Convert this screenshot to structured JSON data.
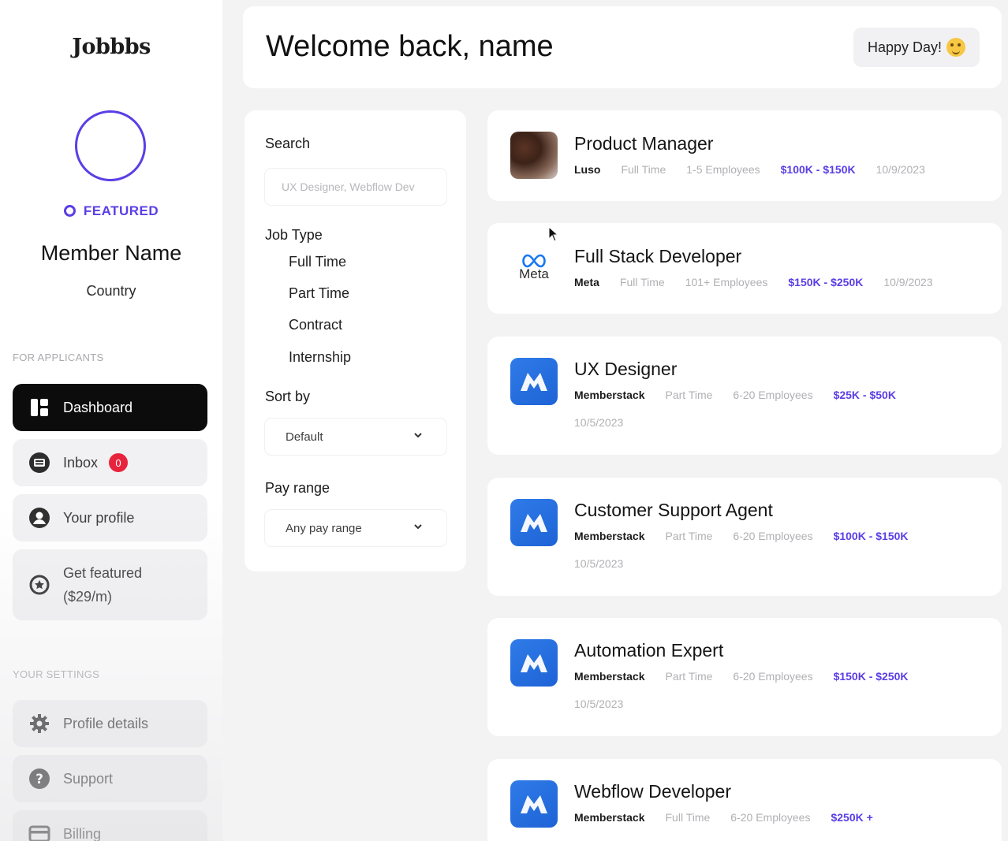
{
  "sidebar": {
    "logo": "Jobbbs",
    "featured_label": "FEATURED",
    "member_name": "Member Name",
    "country": "Country",
    "section_applicants": "FOR APPLICANTS",
    "section_settings": "YOUR SETTINGS",
    "nav": [
      {
        "label": "Dashboard",
        "icon": "dashboard-icon",
        "active": true
      },
      {
        "label": "Inbox",
        "icon": "inbox-icon",
        "badge": "0"
      },
      {
        "label": "Your profile",
        "icon": "user-icon"
      },
      {
        "label": "Get featured",
        "label2": "($29/m)",
        "icon": "star-badge-icon"
      }
    ],
    "settings": [
      {
        "label": "Profile details",
        "icon": "gear-icon"
      },
      {
        "label": "Support",
        "icon": "help-icon"
      },
      {
        "label": "Billing",
        "icon": "credit-card-icon"
      }
    ]
  },
  "header": {
    "welcome": "Welcome back, name",
    "greeting": "Happy Day!",
    "greeting_icon": "party-face-icon"
  },
  "filters": {
    "search_label": "Search",
    "search_placeholder": "UX Designer, Webflow Dev",
    "job_type_label": "Job Type",
    "job_types": [
      "Full Time",
      "Part Time",
      "Contract",
      "Internship"
    ],
    "sort_label": "Sort by",
    "sort_value": "Default",
    "pay_label": "Pay range",
    "pay_value": "Any pay range"
  },
  "jobs": [
    {
      "title": "Product Manager",
      "company": "Luso",
      "type": "Full Time",
      "size": "1-5 Employees",
      "pay": "$100K - $150K",
      "date": "10/9/2023",
      "logo": "photo"
    },
    {
      "title": "Full Stack Developer",
      "company": "Meta",
      "type": "Full Time",
      "size": "101+ Employees",
      "pay": "$150K - $250K",
      "date": "10/9/2023",
      "logo": "meta",
      "logo_text": "Meta"
    },
    {
      "title": "UX Designer",
      "company": "Memberstack",
      "type": "Part Time",
      "size": "6-20 Employees",
      "pay": "$25K - $50K",
      "date": "10/5/2023",
      "logo": "memberstack"
    },
    {
      "title": "Customer Support Agent",
      "company": "Memberstack",
      "type": "Part Time",
      "size": "6-20 Employees",
      "pay": "$100K - $150K",
      "date": "10/5/2023",
      "logo": "memberstack"
    },
    {
      "title": "Automation Expert",
      "company": "Memberstack",
      "type": "Part Time",
      "size": "6-20 Employees",
      "pay": "$150K - $250K",
      "date": "10/5/2023",
      "logo": "memberstack"
    },
    {
      "title": "Webflow Developer",
      "company": "Memberstack",
      "type": "Full Time",
      "size": "6-20 Employees",
      "pay": "$250K +",
      "logo": "memberstack"
    }
  ],
  "colors": {
    "accent": "#5b3ee6",
    "badge": "#e8233c",
    "active_nav": "#0c0c0c",
    "logo_blue": "#2f7be8"
  }
}
